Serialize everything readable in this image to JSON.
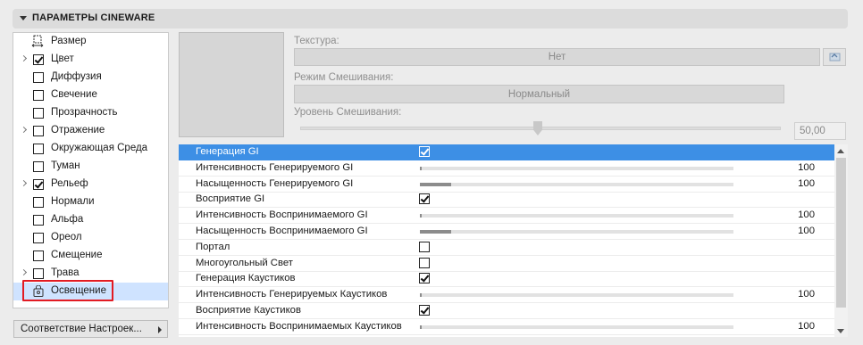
{
  "header": {
    "title": "ПАРАМЕТРЫ CINEWARE"
  },
  "sidebar": {
    "items": [
      {
        "label": "Размер",
        "has_arrow": false,
        "checkbox": null,
        "icon": "size-icon"
      },
      {
        "label": "Цвет",
        "has_arrow": true,
        "checkbox": true
      },
      {
        "label": "Диффузия",
        "has_arrow": false,
        "checkbox": false
      },
      {
        "label": "Свечение",
        "has_arrow": false,
        "checkbox": false
      },
      {
        "label": "Прозрачность",
        "has_arrow": false,
        "checkbox": false
      },
      {
        "label": "Отражение",
        "has_arrow": true,
        "checkbox": false
      },
      {
        "label": "Окружающая Среда",
        "has_arrow": false,
        "checkbox": false
      },
      {
        "label": "Туман",
        "has_arrow": false,
        "checkbox": false
      },
      {
        "label": "Рельеф",
        "has_arrow": true,
        "checkbox": true
      },
      {
        "label": "Нормали",
        "has_arrow": false,
        "checkbox": false
      },
      {
        "label": "Альфа",
        "has_arrow": false,
        "checkbox": false
      },
      {
        "label": "Ореол",
        "has_arrow": false,
        "checkbox": false
      },
      {
        "label": "Смещение",
        "has_arrow": false,
        "checkbox": false
      },
      {
        "label": "Трава",
        "has_arrow": true,
        "checkbox": false
      },
      {
        "label": "Освещение",
        "has_arrow": false,
        "checkbox": null,
        "icon": "lock-icon",
        "selected": true
      }
    ],
    "match_button": "Соответствие Настроек..."
  },
  "texture": {
    "label": "Текстура:",
    "value": "Нет"
  },
  "blend_mode": {
    "label": "Режим Смешивания:",
    "value": "Нормальный"
  },
  "blend_level": {
    "label": "Уровень Смешивания:",
    "value": "50,00",
    "fraction": 0.5
  },
  "table": {
    "rows": [
      {
        "name": "Генерация GI",
        "type": "checkbox",
        "checked": true,
        "selected": true
      },
      {
        "name": "Интенсивность Генерируемого GI",
        "type": "slider",
        "value": "100",
        "fill": 0.005
      },
      {
        "name": "Насыщенность Генерируемого GI",
        "type": "slider",
        "value": "100",
        "fill": 0.1
      },
      {
        "name": "Восприятие GI",
        "type": "checkbox",
        "checked": true
      },
      {
        "name": "Интенсивность Воспринимаемого GI",
        "type": "slider",
        "value": "100",
        "fill": 0.005
      },
      {
        "name": "Насыщенность Воспринимаемого GI",
        "type": "slider",
        "value": "100",
        "fill": 0.1
      },
      {
        "name": "Портал",
        "type": "checkbox",
        "checked": false
      },
      {
        "name": "Многоугольный Свет",
        "type": "checkbox",
        "checked": false
      },
      {
        "name": "Генерация Каустиков",
        "type": "checkbox",
        "checked": true
      },
      {
        "name": "Интенсивность Генерируемых Каустиков",
        "type": "slider",
        "value": "100",
        "fill": 0.005
      },
      {
        "name": "Восприятие Каустиков",
        "type": "checkbox",
        "checked": true
      },
      {
        "name": "Интенсивность Воспринимаемых Каустиков",
        "type": "slider",
        "value": "100",
        "fill": 0.005
      }
    ]
  },
  "colors": {
    "selection": "#3d8fe5",
    "sidebar_selection": "#cfe3ff",
    "highlight_box": "#e21b23"
  }
}
